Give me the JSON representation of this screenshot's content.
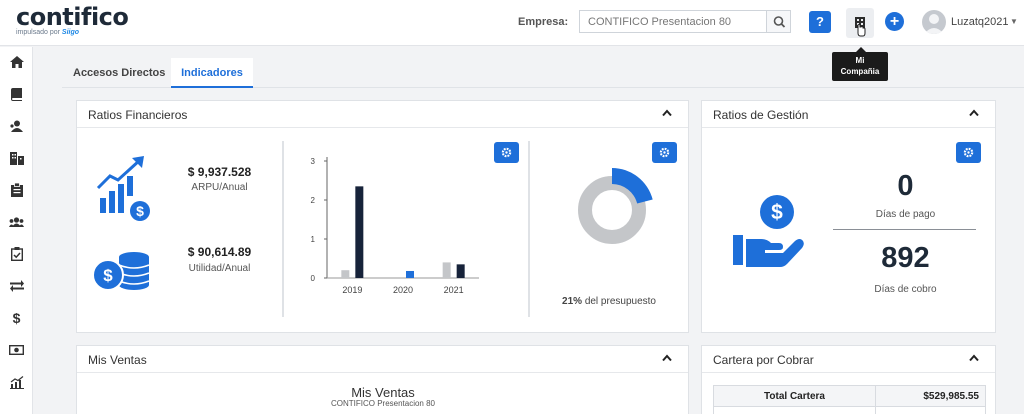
{
  "header": {
    "logo": "contifico",
    "logo_sub_prefix": "impulsado por",
    "logo_sub_brand": "Siigo",
    "empresa_label": "Empresa:",
    "empresa_value": "CONTIFICO Presentacion 80",
    "help_glyph": "?",
    "plus_glyph": "+",
    "user_name": "Luzatq2021",
    "user_caret": "▼",
    "tooltip_line1": "Mi",
    "tooltip_line2": "Compañia"
  },
  "sidebar": {
    "items": [
      "home-icon",
      "book-icon",
      "users-icon",
      "building-icon",
      "clipboard-icon",
      "group-icon",
      "checklist-icon",
      "transfer-icon",
      "dollar-icon",
      "cash-icon",
      "chart-icon"
    ],
    "dollar_glyph": "$"
  },
  "tabs": [
    {
      "label": "Accesos Directos",
      "active": false
    },
    {
      "label": "Indicadores",
      "active": true
    }
  ],
  "ratios_financieros": {
    "title": "Ratios Financieros",
    "arpu_value": "$ 9,937.528",
    "arpu_label": "ARPU/Anual",
    "utilidad_value": "$ 90,614.89",
    "utilidad_label": "Utilidad/Anual",
    "presupuesto_pct": "21%",
    "presupuesto_label": "del presupuesto",
    "presupuesto_fraction": 0.21
  },
  "chart_data": {
    "type": "bar",
    "categories": [
      "2019",
      "2020",
      "2021"
    ],
    "yticks": [
      "0",
      "1",
      "2",
      "3"
    ],
    "ylim": [
      0,
      3
    ],
    "series": [
      {
        "values": [
          0.2,
          0,
          0.4
        ],
        "color": "#c4c6c9"
      },
      {
        "values": [
          2.35,
          0.18,
          0.35
        ],
        "color": "#17233a"
      }
    ],
    "highlight": {
      "category": "2020",
      "series": 1,
      "color": "#1e6fd9"
    }
  },
  "ratios_gestion": {
    "title": "Ratios de Gestión",
    "dias_pago_value": "0",
    "dias_pago_label": "Días de pago",
    "dias_cobro_value": "892",
    "dias_cobro_label": "Días de cobro"
  },
  "mis_ventas": {
    "title": "Mis Ventas",
    "chart_title": "Mis Ventas",
    "chart_subtitle": "CONTIFICO Presentacion 80"
  },
  "cartera": {
    "title": "Cartera por Cobrar",
    "total_label": "Total Cartera",
    "total_value": "$529,985.55"
  },
  "colors": {
    "accent": "#1e6fd9",
    "dark": "#17233a",
    "gray_bar": "#c4c6c9"
  }
}
